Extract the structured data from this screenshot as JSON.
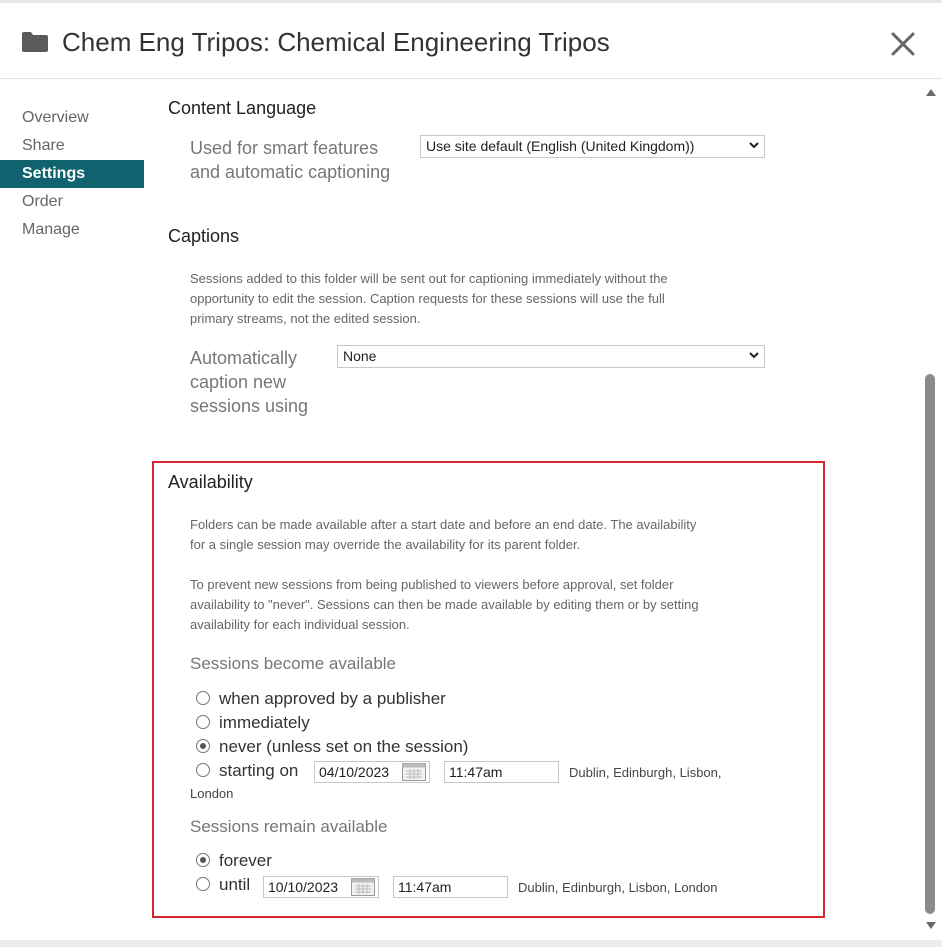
{
  "header": {
    "title": "Chem Eng Tripos: Chemical Engineering Tripos"
  },
  "sidebar": {
    "items": [
      {
        "label": "Overview"
      },
      {
        "label": "Share"
      },
      {
        "label": "Settings"
      },
      {
        "label": "Order"
      },
      {
        "label": "Manage"
      }
    ],
    "active": "Settings"
  },
  "content_language": {
    "heading": "Content Language",
    "label_line1": "Used for smart features",
    "label_line2": "and automatic captioning",
    "selected": "Use site default (English (United Kingdom))"
  },
  "captions": {
    "heading": "Captions",
    "desc_line1": "Sessions added to this folder will be sent out for captioning immediately without the",
    "desc_line2": "opportunity to edit the session. Caption requests for these sessions will use the full",
    "desc_line3": "primary streams, not the edited session.",
    "label_line1": "Automatically",
    "label_line2": "caption new",
    "label_line3": "sessions using",
    "selected": "None"
  },
  "availability": {
    "heading": "Availability",
    "p1_line1": "Folders can be made available after a start date and before an end date. The availability",
    "p1_line2": "for a single session may override the availability for its parent folder.",
    "p2_line1": "To prevent new sessions from being published to viewers before approval, set folder",
    "p2_line2": "availability to \"never\". Sessions can then be made available by editing them or by setting",
    "p2_line3": "availability for each individual session.",
    "become": {
      "label": "Sessions become available",
      "options": [
        {
          "label": "when approved by a publisher",
          "checked": false
        },
        {
          "label": "immediately",
          "checked": false
        },
        {
          "label": "never (unless set on the session)",
          "checked": true
        },
        {
          "label": "starting on",
          "checked": false
        }
      ],
      "date": "04/10/2023",
      "time": "11:47am",
      "tz_line1": "Dublin, Edinburgh, Lisbon,",
      "tz_line2": "London"
    },
    "remain": {
      "label": "Sessions remain available",
      "options": [
        {
          "label": "forever",
          "checked": true
        },
        {
          "label": "until",
          "checked": false
        }
      ],
      "date": "10/10/2023",
      "time": "11:47am",
      "tz": "Dublin, Edinburgh, Lisbon, London"
    }
  },
  "colors": {
    "accent": "#10636e",
    "highlight": "#d9252f"
  },
  "icons": {
    "folder": "folder-icon",
    "close": "close-icon",
    "calendar": "calendar-icon",
    "chevron": "chevron-down-icon"
  }
}
